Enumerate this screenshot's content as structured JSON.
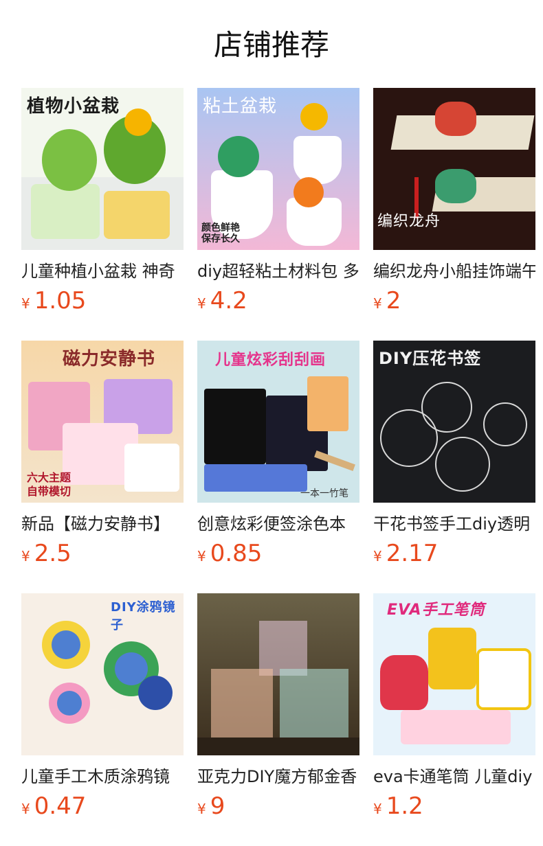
{
  "header": {
    "title": "店铺推荐"
  },
  "currency": "¥",
  "products": [
    {
      "name": "儿童种植小盆栽 神奇",
      "price": "1.05",
      "image_caption": "植物小盆栽",
      "image_note": ""
    },
    {
      "name": "diy超轻粘土材料包 多",
      "price": "4.2",
      "image_caption": "粘土盆栽",
      "image_note": "颜色鲜艳\n保存长久"
    },
    {
      "name": "编织龙舟小船挂饰端午",
      "price": "2",
      "image_caption": "编织龙舟",
      "image_note": ""
    },
    {
      "name": "新品【磁力安静书】",
      "price": "2.5",
      "image_caption": "磁力安静书",
      "image_note": "六大主题\n自带模切"
    },
    {
      "name": "创意炫彩便签涂色本",
      "price": "0.85",
      "image_caption": "儿童炫彩刮刮画",
      "image_note": "一本一竹笔"
    },
    {
      "name": "干花书签手工diy透明",
      "price": "2.17",
      "image_caption": "DIY压花书签",
      "image_note": ""
    },
    {
      "name": "儿童手工木质涂鸦镜",
      "price": "0.47",
      "image_caption": "DIY涂鸦镜子",
      "image_note": ""
    },
    {
      "name": "亚克力DIY魔方郁金香",
      "price": "9",
      "image_caption": "",
      "image_note": ""
    },
    {
      "name": "eva卡通笔筒 儿童diy",
      "price": "1.2",
      "image_caption": "EVA手工笔筒",
      "image_note": ""
    }
  ],
  "colors": {
    "price": "#e8491d",
    "title": "#111111",
    "name": "#222222"
  }
}
